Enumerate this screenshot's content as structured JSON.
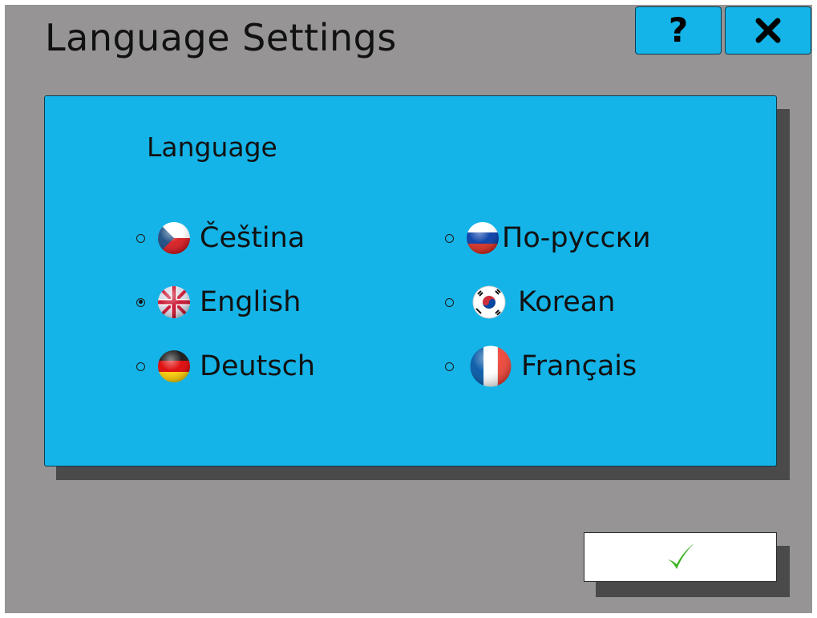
{
  "window": {
    "title": "Language Settings",
    "help_label": "?",
    "close_label": "✕"
  },
  "panel": {
    "label": "Language"
  },
  "languages": [
    {
      "label": "Čeština",
      "flag": "czech-flag-icon",
      "selected": false
    },
    {
      "label": "English",
      "flag": "uk-flag-icon",
      "selected": true
    },
    {
      "label": "Deutsch",
      "flag": "german-flag-icon",
      "selected": false
    },
    {
      "label": "По-русски",
      "flag": "russian-flag-icon",
      "selected": false
    },
    {
      "label": "Korean",
      "flag": "korean-flag-icon",
      "selected": false
    },
    {
      "label": "Français",
      "flag": "french-flag-icon",
      "selected": false
    }
  ],
  "footer": {
    "ok_icon": "checkmark-icon"
  },
  "colors": {
    "background": "#969494",
    "accent": "#14b4e8",
    "check": "#3cb521"
  }
}
